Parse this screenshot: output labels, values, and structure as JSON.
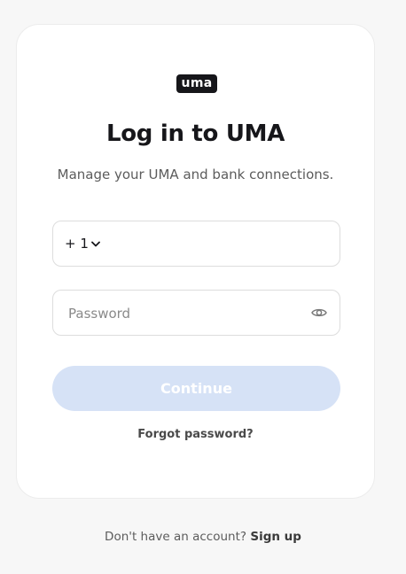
{
  "logo": {
    "text": "uma"
  },
  "login": {
    "title": "Log in to UMA",
    "subtitle": "Manage your UMA and bank connections.",
    "country_code": "+ 1",
    "phone_value": "",
    "password_placeholder": "Password",
    "continue_label": "Continue",
    "forgot_label": "Forgot password?"
  },
  "footer": {
    "prompt": "Don't have an account?",
    "signup_label": "Sign up"
  },
  "colors": {
    "button_disabled": "#d6e2f6",
    "background": "#f7f7f7",
    "text_primary": "#16161a"
  },
  "icons": {
    "country_dropdown": "chevron-down-icon",
    "password_toggle": "eye-icon"
  }
}
